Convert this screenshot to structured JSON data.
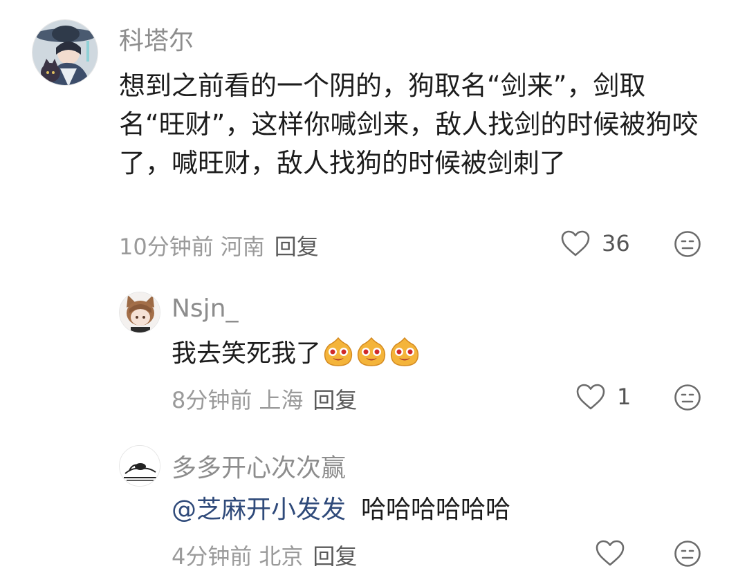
{
  "comments": [
    {
      "author": "科塔尔",
      "text": "想到之前看的一个阴的，狗取名“剑来”，剑取名“旺财”，这样你喊剑来，敌人找剑的时候被狗咬了，喊旺财，敌人找狗的时候被剑刺了",
      "time": "10分钟前",
      "location": "河南",
      "reply_label": "回复",
      "likes": "36",
      "avatar_icon": "anime-character-avatar",
      "like_icon": "heart-outline-icon",
      "dislike_icon": "meh-face-icon"
    },
    {
      "author": "Nsjn_",
      "text": "我去笑死我了",
      "emoji": [
        "laughing-face-emoji",
        "laughing-face-emoji",
        "laughing-face-emoji"
      ],
      "time": "8分钟前",
      "location": "上海",
      "reply_label": "回复",
      "likes": "1",
      "avatar_icon": "anime-boy-cat-ears-avatar",
      "like_icon": "heart-outline-icon",
      "dislike_icon": "meh-face-icon"
    },
    {
      "author": "多多开心次次赢",
      "mention": "@芝麻开小发发",
      "text": "哈哈哈哈哈哈",
      "time": "4分钟前",
      "location": "北京",
      "reply_label": "回复",
      "likes": "",
      "avatar_icon": "sleeping-doodle-avatar",
      "like_icon": "heart-outline-icon",
      "dislike_icon": "meh-face-icon"
    }
  ],
  "colors": {
    "author": "#8d8d8d",
    "body": "#1c1c1c",
    "meta": "#9a9a9a",
    "mention": "#2f4a7a"
  }
}
